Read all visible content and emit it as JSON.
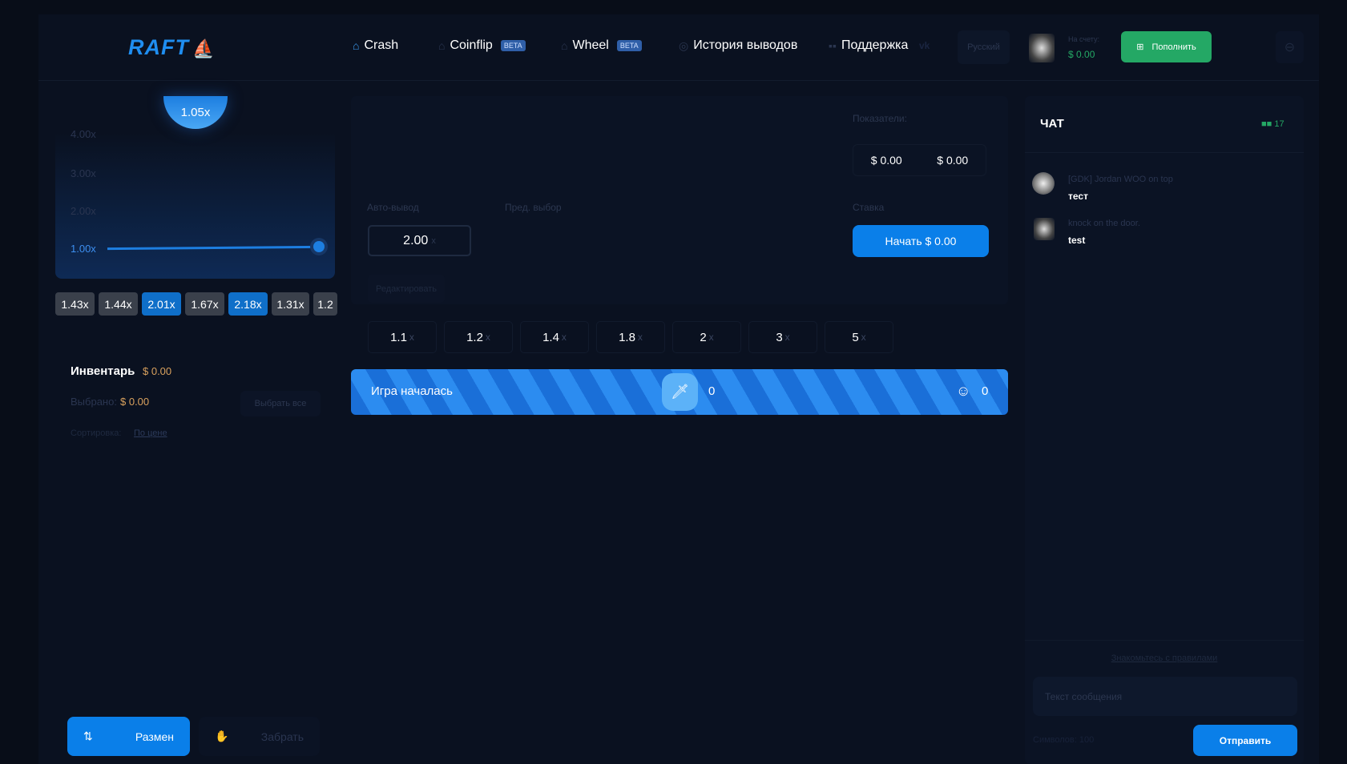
{
  "header": {
    "logo": "RAFT",
    "nav": [
      {
        "label": "Crash",
        "icon": "home-icon"
      },
      {
        "label": "Coinflip",
        "badge": "BETA",
        "icon": "home-icon"
      },
      {
        "label": "Wheel",
        "badge": "BETA",
        "icon": "home-icon"
      },
      {
        "label": "История выводов",
        "icon": "history-icon"
      },
      {
        "label": "Поддержка",
        "icon": "chat-icon"
      }
    ],
    "language": "Русский",
    "balance_label": "На счету:",
    "balance": "$ 0.00",
    "deposit_label": "Пополнить"
  },
  "graph": {
    "current": "1.05x",
    "y_ticks": [
      "4.00x",
      "3.00x",
      "2.00x",
      "1.00x"
    ],
    "history": [
      "1.43x",
      "1.44x",
      "2.01x",
      "1.67x",
      "2.18x",
      "1.31x",
      "1.2"
    ],
    "history_highlight": [
      false,
      false,
      true,
      false,
      true,
      false,
      false
    ]
  },
  "inventory": {
    "title": "Инвентарь",
    "total": "$ 0.00",
    "selected_label": "Выбрано:",
    "selected": "$ 0.00",
    "select_all": "Выбрать все",
    "sort_label": "Сортировка:",
    "sort_value": "По цене"
  },
  "actions": {
    "exchange": "Размен",
    "withdraw": "Забрать"
  },
  "bet": {
    "stats_label": "Показатели:",
    "stat1": "$ 0.00",
    "stat2": "$ 0.00",
    "auto_label": "Авто-вывод",
    "auto_value": "2.00",
    "auto_suffix": "x",
    "pre_label": "Пред. выбор",
    "bet_label": "Ставка",
    "start": "Начать $ 0.00",
    "edit": "Редактировать",
    "quick": [
      "1.1",
      "1.2",
      "1.4",
      "1.8",
      "2",
      "3",
      "5"
    ],
    "quick_suffix": "x"
  },
  "banner": {
    "status": "Игра началась",
    "items_count": "0",
    "players_count": "0"
  },
  "chat": {
    "title": "ЧАТ",
    "online": "17",
    "messages": [
      {
        "user": "[GDK] Jordan WOO on top",
        "text": "тест"
      },
      {
        "user": "knock on the door.",
        "text": "test"
      }
    ],
    "rules": "Знакомьтесь с правилами",
    "placeholder": "Текст сообщения",
    "chars": "Символов: 100",
    "send": "Отправить"
  },
  "colors": {
    "accent": "#0a7fe9",
    "success": "#24a865",
    "gold": "#d9a15e"
  }
}
